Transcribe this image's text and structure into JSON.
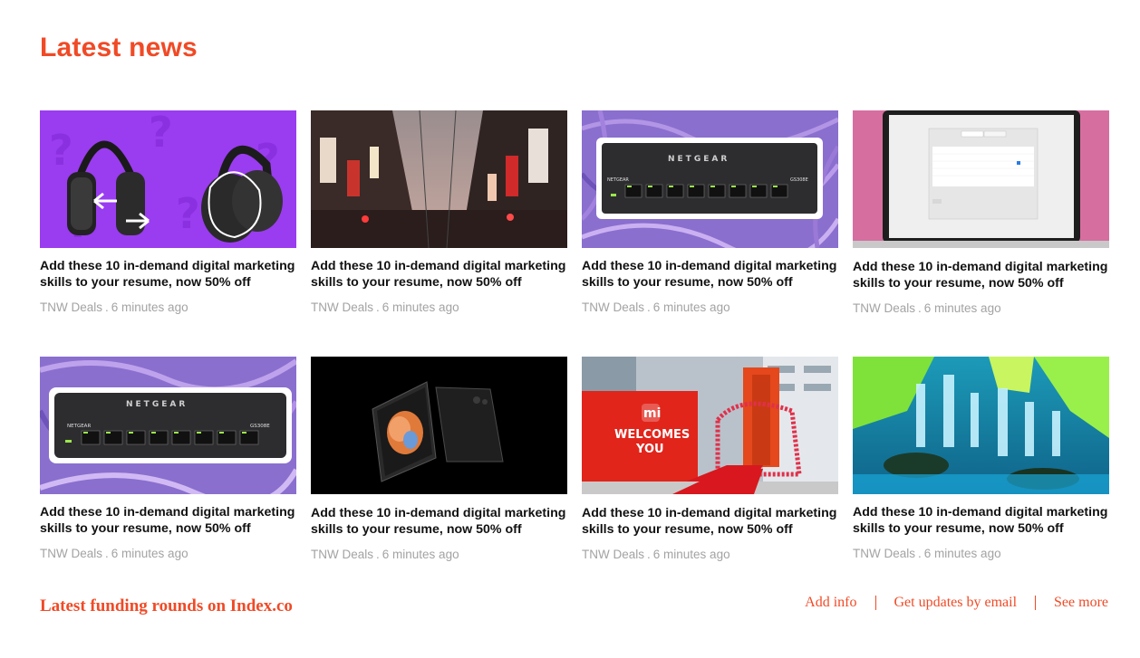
{
  "section": {
    "title": "Latest news"
  },
  "articles": [
    {
      "title": "Add these 10 in-demand digital marketing skills to your resume, now 50% off",
      "source": "TNW Deals",
      "time": "6 minutes ago",
      "image": "headphones-comparison-image"
    },
    {
      "title": "Add these 10 in-demand digital marketing skills to your resume, now 50% off",
      "source": "TNW Deals",
      "time": "6 minutes ago",
      "image": "city-street-signs-image"
    },
    {
      "title": "Add these 10 in-demand digital marketing skills to your resume, now 50% off",
      "source": "TNW Deals",
      "time": "6 minutes ago",
      "image": "netgear-switch-image"
    },
    {
      "title": "Add these 10 in-demand digital marketing skills to your resume, now 50% off",
      "source": "TNW Deals",
      "time": "6 minutes ago",
      "image": "macbook-login-items-image"
    },
    {
      "title": "Add these 10 in-demand digital marketing skills to your resume, now 50% off",
      "source": "TNW Deals",
      "time": "6 minutes ago",
      "image": "netgear-switch-image"
    },
    {
      "title": "Add these 10 in-demand digital marketing skills to your resume, now 50% off",
      "source": "TNW Deals",
      "time": "6 minutes ago",
      "image": "foldable-phone-image"
    },
    {
      "title": "Add these 10 in-demand digital marketing skills to your resume, now 50% off",
      "source": "TNW Deals",
      "time": "6 minutes ago",
      "image": "xiaomi-store-image"
    },
    {
      "title": "Add these 10 in-demand digital marketing skills to your resume, now 50% off",
      "source": "TNW Deals",
      "time": "6 minutes ago",
      "image": "waterfall-image"
    }
  ],
  "image_text": {
    "netgear_brand": "NETGEAR",
    "netgear_model": "GS308E",
    "mi_logo": "mi",
    "welcome_line1": "WELCOMES",
    "welcome_line2": "YOU"
  },
  "footer": {
    "funding_link": "Latest funding rounds on Index.co",
    "add_info": "Add info",
    "get_updates": "Get updates by email",
    "see_more": "See more"
  },
  "colors": {
    "accent": "#f04a26",
    "meta_text": "#a3a3a3",
    "title_text": "#111111"
  }
}
